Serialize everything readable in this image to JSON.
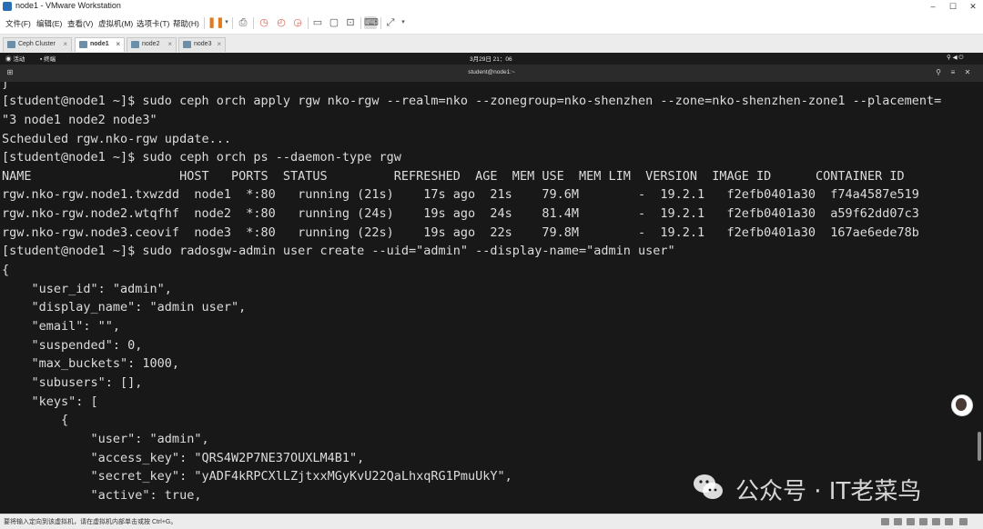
{
  "window": {
    "title": "node1 - VMware Workstation",
    "controls": [
      "–",
      "☐",
      "✕"
    ]
  },
  "menu": {
    "items": [
      "文件(F)",
      "编辑(E)",
      "查看(V)",
      "虚拟机(M)",
      "选项卡(T)",
      "帮助(H)"
    ]
  },
  "tabs": [
    {
      "label": "Ceph Cluster",
      "active": false
    },
    {
      "label": "node1",
      "active": true
    },
    {
      "label": "node2",
      "active": false
    },
    {
      "label": "node3",
      "active": false
    }
  ],
  "gnome": {
    "activities": "活动",
    "terminal_app": "终端",
    "clock": "3月29日 21：06"
  },
  "terminal": {
    "title": "student@node1:~",
    "lines": [
      "ƒ",
      "[student@node1 ~]$ sudo ceph orch apply rgw nko-rgw --realm=nko --zonegroup=nko-shenzhen --zone=nko-shenzhen-zone1 --placement=",
      "\"3 node1 node2 node3\"",
      "Scheduled rgw.nko-rgw update...",
      "[student@node1 ~]$ sudo ceph orch ps --daemon-type rgw",
      "NAME                    HOST   PORTS  STATUS         REFRESHED  AGE  MEM USE  MEM LIM  VERSION  IMAGE ID      CONTAINER ID",
      "rgw.nko-rgw.node1.txwzdd  node1  *:80   running (21s)    17s ago  21s    79.6M        -  19.2.1   f2efb0401a30  f74a4587e519",
      "rgw.nko-rgw.node2.wtqfhf  node2  *:80   running (24s)    19s ago  24s    81.4M        -  19.2.1   f2efb0401a30  a59f62dd07c3",
      "rgw.nko-rgw.node3.ceovif  node3  *:80   running (22s)    19s ago  22s    79.8M        -  19.2.1   f2efb0401a30  167ae6ede78b",
      "[student@node1 ~]$ sudo radosgw-admin user create --uid=\"admin\" --display-name=\"admin user\"",
      "{",
      "    \"user_id\": \"admin\",",
      "    \"display_name\": \"admin user\",",
      "    \"email\": \"\",",
      "    \"suspended\": 0,",
      "    \"max_buckets\": 1000,",
      "    \"subusers\": [],",
      "    \"keys\": [",
      "        {",
      "            \"user\": \"admin\",",
      "            \"access_key\": \"QRS4W2P7NE37OUXLM4B1\",",
      "            \"secret_key\": \"yADF4kRPCXlLZjtxxMGyKvU22QaLhxqRG1PmuUkY\",",
      "            \"active\": true,"
    ]
  },
  "status_bar": {
    "text": "要将输入定向到该虚拟机，请在虚拟机内部单击或按 Ctrl+G。"
  },
  "watermark": {
    "text": "公众号 · IT老菜鸟"
  },
  "colors": {
    "terminal_bg": "#181818",
    "terminal_fg": "#dcdcdc",
    "accent_pause": "#e07a1f"
  }
}
